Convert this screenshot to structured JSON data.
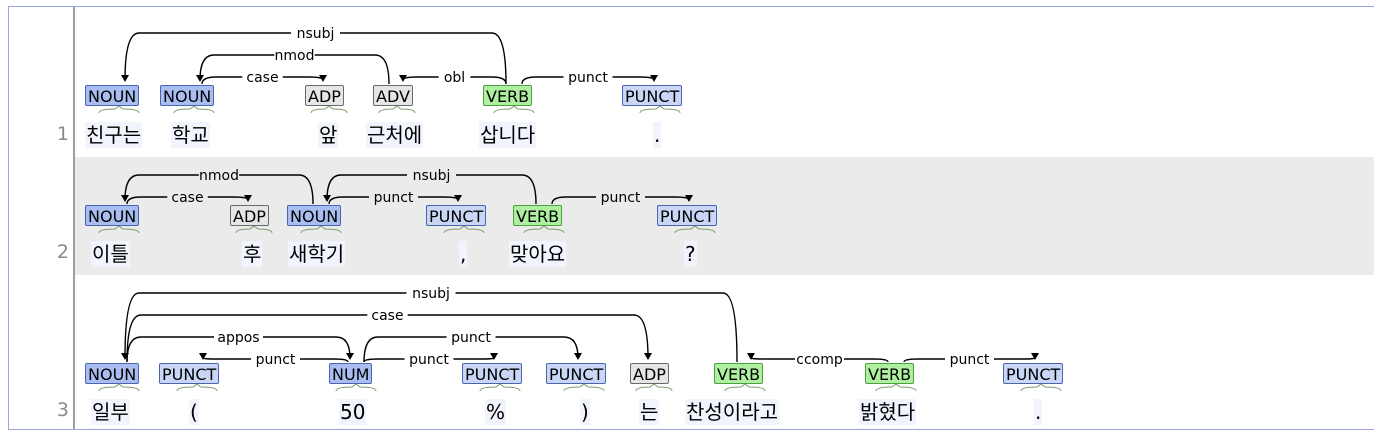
{
  "sentences": [
    {
      "number": "1",
      "tokens": [
        {
          "text": "친구는",
          "pos": "NOUN"
        },
        {
          "text": "학교",
          "pos": "NOUN"
        },
        {
          "text": "앞",
          "pos": "ADP"
        },
        {
          "text": "근처에",
          "pos": "ADV"
        },
        {
          "text": "삽니다",
          "pos": "VERB"
        },
        {
          "text": ".",
          "pos": "PUNCT"
        }
      ],
      "arcs": [
        {
          "from": 5,
          "to": 1,
          "label": "nsubj"
        },
        {
          "from": 4,
          "to": 2,
          "label": "nmod"
        },
        {
          "from": 2,
          "to": 3,
          "label": "case"
        },
        {
          "from": 5,
          "to": 4,
          "label": "obl"
        },
        {
          "from": 5,
          "to": 6,
          "label": "punct"
        }
      ]
    },
    {
      "number": "2",
      "tokens": [
        {
          "text": "이틀",
          "pos": "NOUN"
        },
        {
          "text": "후",
          "pos": "ADP"
        },
        {
          "text": "새학기",
          "pos": "NOUN"
        },
        {
          "text": ",",
          "pos": "PUNCT"
        },
        {
          "text": "맞아요",
          "pos": "VERB"
        },
        {
          "text": "?",
          "pos": "PUNCT"
        }
      ],
      "arcs": [
        {
          "from": 3,
          "to": 1,
          "label": "nmod"
        },
        {
          "from": 1,
          "to": 2,
          "label": "case"
        },
        {
          "from": 5,
          "to": 3,
          "label": "nsubj"
        },
        {
          "from": 3,
          "to": 4,
          "label": "punct"
        },
        {
          "from": 5,
          "to": 6,
          "label": "punct"
        }
      ]
    },
    {
      "number": "3",
      "tokens": [
        {
          "text": "일부",
          "pos": "NOUN"
        },
        {
          "text": "(",
          "pos": "PUNCT"
        },
        {
          "text": "50",
          "pos": "NUM"
        },
        {
          "text": "%",
          "pos": "PUNCT"
        },
        {
          "text": ")",
          "pos": "PUNCT"
        },
        {
          "text": "는",
          "pos": "ADP"
        },
        {
          "text": "찬성이라고",
          "pos": "VERB"
        },
        {
          "text": "밝혔다",
          "pos": "VERB"
        },
        {
          "text": ".",
          "pos": "PUNCT"
        }
      ],
      "arcs": [
        {
          "from": 7,
          "to": 1,
          "label": "nsubj"
        },
        {
          "from": 1,
          "to": 6,
          "label": "case"
        },
        {
          "from": 1,
          "to": 3,
          "label": "appos"
        },
        {
          "from": 3,
          "to": 2,
          "label": "punct"
        },
        {
          "from": 3,
          "to": 5,
          "label": "punct"
        },
        {
          "from": 3,
          "to": 4,
          "label": "punct"
        },
        {
          "from": 8,
          "to": 7,
          "label": "ccomp"
        },
        {
          "from": 8,
          "to": 9,
          "label": "punct"
        }
      ]
    }
  ]
}
